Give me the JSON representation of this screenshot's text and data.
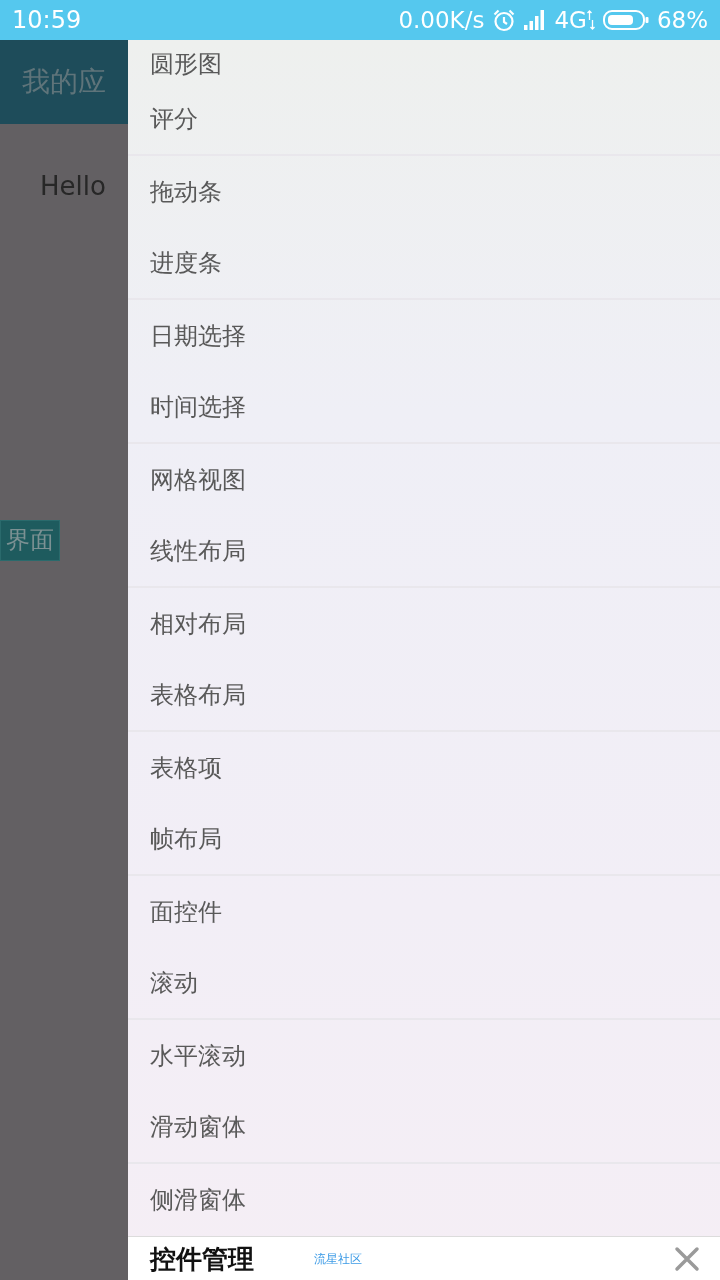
{
  "status_bar": {
    "time": "10:59",
    "network_speed": "0.00K/s",
    "network_type": "4G",
    "battery": "68%"
  },
  "background_app": {
    "toolbar_title": "我的应",
    "content_text": "Hello",
    "button": "界面"
  },
  "drawer": {
    "items": [
      {
        "label": "圆形图"
      },
      {
        "label": "评分"
      },
      {
        "label": "拖动条"
      },
      {
        "label": "进度条"
      },
      {
        "label": "日期选择"
      },
      {
        "label": "时间选择"
      },
      {
        "label": "网格视图"
      },
      {
        "label": "线性布局"
      },
      {
        "label": "相对布局"
      },
      {
        "label": "表格布局"
      },
      {
        "label": "表格项"
      },
      {
        "label": "帧布局"
      },
      {
        "label": "面控件"
      },
      {
        "label": "滚动"
      },
      {
        "label": "水平滚动"
      },
      {
        "label": "滑动窗体"
      },
      {
        "label": "侧滑窗体"
      }
    ]
  },
  "bottom_panel": {
    "title": "控件管理",
    "link": "流星社区"
  }
}
